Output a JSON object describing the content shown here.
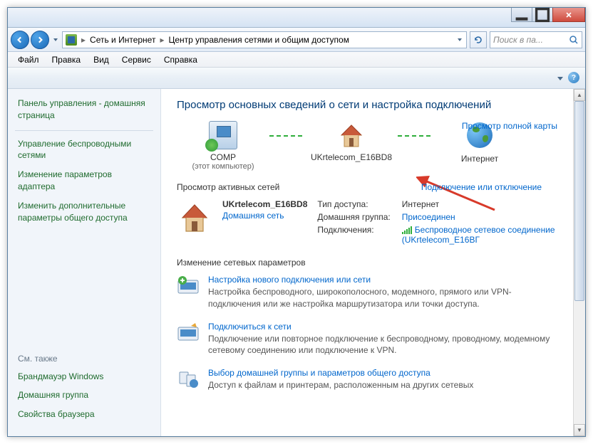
{
  "breadcrumb": {
    "part1": "Сеть и Интернет",
    "part2": "Центр управления сетями и общим доступом"
  },
  "search": {
    "placeholder": "Поиск в па..."
  },
  "menus": {
    "file": "Файл",
    "edit": "Правка",
    "view": "Вид",
    "service": "Сервис",
    "help": "Справка"
  },
  "sidebar": {
    "title": "Панель управления - домашняя страница",
    "links": [
      "Управление беспроводными сетями",
      "Изменение параметров адаптера",
      "Изменить дополнительные параметры общего доступа"
    ],
    "seealso": "См. также",
    "bottom": [
      "Брандмауэр Windows",
      "Домашняя группа",
      "Свойства браузера"
    ]
  },
  "main": {
    "heading": "Просмотр основных сведений о сети и настройка подключений",
    "map": {
      "comp": "COMP",
      "comp_sub": "(этот компьютер)",
      "net": "UKrtelecom_E16BD8",
      "inet": "Интернет",
      "full_map": "Просмотр полной карты"
    },
    "active_title": "Просмотр активных сетей",
    "conn_toggle": "Подключение или отключение",
    "active": {
      "name": "UKrtelecom_E16BD8",
      "type": "Домашняя сеть"
    },
    "props": {
      "access_k": "Тип доступа:",
      "access_v": "Интернет",
      "home_k": "Домашняя группа:",
      "home_v": "Присоединен",
      "conn_k": "Подключения:",
      "conn_v": "Беспроводное сетевое соединение (UKrtelecom_E16BГ"
    },
    "change_title": "Изменение сетевых параметров",
    "tasks": [
      {
        "title": "Настройка нового подключения или сети",
        "desc": "Настройка беспроводного, широкополосного, модемного, прямого или VPN-подключения или же настройка маршрутизатора или точки доступа."
      },
      {
        "title": "Подключиться к сети",
        "desc": "Подключение или повторное подключение к беспроводному, проводному, модемному сетевому соединению или подключение к VPN."
      },
      {
        "title": "Выбор домашней группы и параметров общего доступа",
        "desc": "Доступ к файлам и принтерам, расположенным на других сетевых"
      }
    ]
  }
}
